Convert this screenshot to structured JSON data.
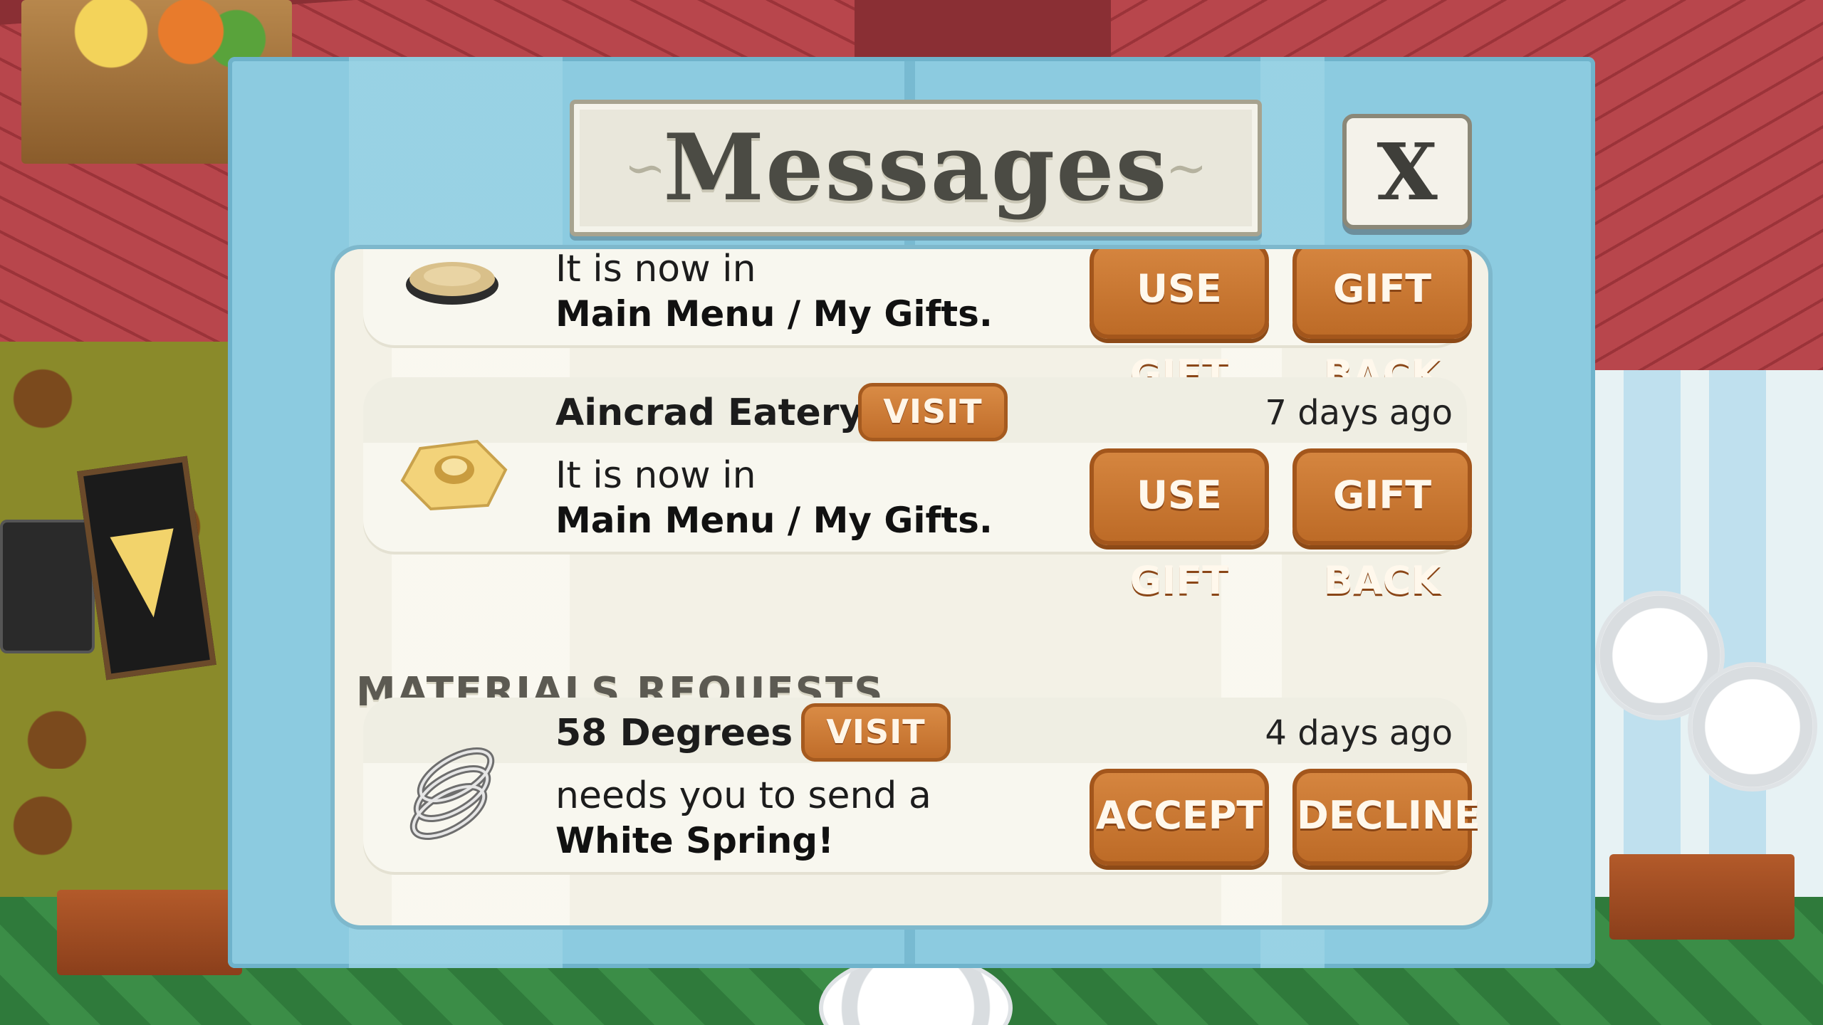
{
  "dialog": {
    "title": "Messages",
    "close_label": "X"
  },
  "messages": [
    {
      "sender": "",
      "time": "",
      "body_line1": "It is now in",
      "body_line2": "Main Menu / My Gifts.",
      "primary_label": "USE GIFT",
      "secondary_label": "GIFT BACK",
      "icon": "gift-item-icon"
    },
    {
      "sender": "Aincrad Eatery",
      "visit_label": "VISIT",
      "time": "7 days ago",
      "body_line1": "It is now in",
      "body_line2": "Main Menu / My Gifts.",
      "primary_label": "USE GIFT",
      "secondary_label": "GIFT BACK",
      "icon": "hex-nut-icon"
    }
  ],
  "materials_requests": {
    "section_title": "MATERIALS REQUESTS",
    "items": [
      {
        "sender": "58 Degrees",
        "visit_label": "VISIT",
        "time": "4 days ago",
        "body_line1": "needs you to send a",
        "body_line2": "White Spring!",
        "primary_label": "ACCEPT",
        "secondary_label": "DECLINE",
        "icon": "white-spring-icon"
      }
    ]
  },
  "colors": {
    "panel_frame": "#8ccbe0",
    "button_orange": "#cf7d36",
    "panel_bg": "#f3f1e6"
  }
}
